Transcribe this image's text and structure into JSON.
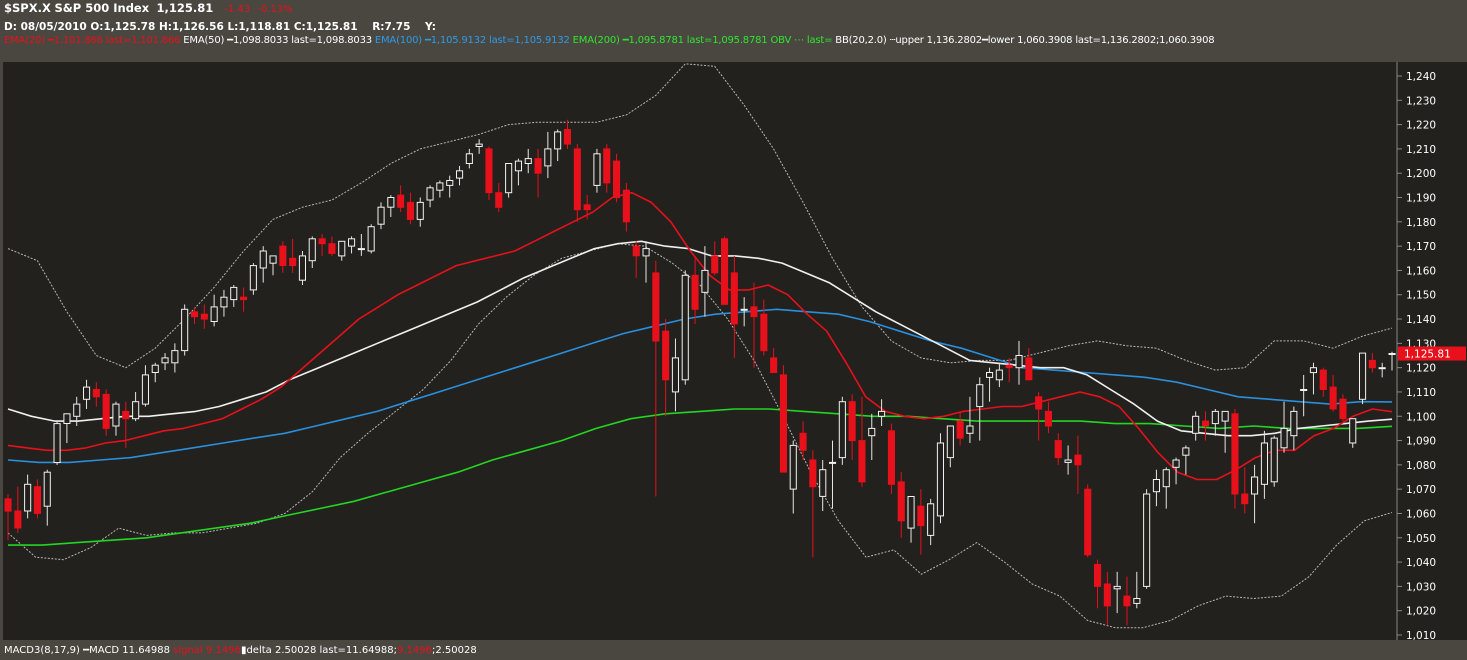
{
  "header": {
    "symbol": "$SPX.X",
    "name": "S&P 500 Index",
    "last": "1,125.81",
    "change": "-1.43",
    "change_pct": "-0.13%",
    "date_label": "D:",
    "date": "08/05/2010",
    "open_label": "O:",
    "open": "1,125.78",
    "high_label": "H:",
    "high": "1,126.56",
    "low_label": "L:",
    "low": "1,118.81",
    "close_label": "C:",
    "close": "1,125.81",
    "range_label": "R:",
    "range": "7.75",
    "y_label": "Y:"
  },
  "indicators": {
    "ema20": "EMA(20) ━1,101.866 last=1,101.866",
    "ema50": "EMA(50) ━1,098.8033 last=1,098.8033",
    "ema100": "EMA(100) ━1,105.9132 last=1,105.9132",
    "ema200": "EMA(200) ━1,095.8781 last=1,095.8781",
    "obv": "OBV ⋯ last=",
    "bb": "BB(20,2.0) ┄upper 1,136.2802━lower 1,060.3908 last=1,136.2802;1,060.3908"
  },
  "footer": {
    "macd": "MACD3(8,17,9) ━MACD 11.64988",
    "signal": "signal 9.1496",
    "delta": "▮delta 2.50028 last=11.64988;",
    "last_signal": "9.1496",
    "last_delta": ";2.50028"
  },
  "colors": {
    "up_body": "#ffffff",
    "down_body": "#e8101a",
    "ema20": "#e8101a",
    "ema50": "#f0f0f0",
    "ema100": "#2a8fdc",
    "ema200": "#22d622",
    "bollinger": "#b8b8b8",
    "last_price_tag": "#e8101a",
    "plot_background": "#22211d"
  },
  "chart_data": {
    "type": "candlestick",
    "ylim": [
      1008,
      1248
    ],
    "y_ticks": [
      "1,010",
      "1,020",
      "1,030",
      "1,040",
      "1,050",
      "1,060",
      "1,070",
      "1,080",
      "1,090",
      "1,100",
      "1,110",
      "1,120",
      "1,130",
      "1,140",
      "1,150",
      "1,160",
      "1,170",
      "1,180",
      "1,190",
      "1,200",
      "1,210",
      "1,220",
      "1,230",
      "1,240"
    ],
    "last_price_label": "1,125.81",
    "last_price": 1125.81,
    "candles": [
      [
        1066,
        1068,
        1049,
        1061
      ],
      [
        1061,
        1071,
        1052,
        1054
      ],
      [
        1061,
        1076,
        1058,
        1072
      ],
      [
        1071,
        1074,
        1058,
        1060
      ],
      [
        1063,
        1078,
        1055,
        1077
      ],
      [
        1081,
        1098,
        1080,
        1097
      ],
      [
        1097,
        1101,
        1089,
        1101
      ],
      [
        1100,
        1108,
        1096,
        1105
      ],
      [
        1107,
        1115,
        1103,
        1112
      ],
      [
        1111,
        1114,
        1104,
        1108
      ],
      [
        1109,
        1111,
        1092,
        1095
      ],
      [
        1096,
        1106,
        1092,
        1105
      ],
      [
        1102,
        1106,
        1087,
        1099
      ],
      [
        1099,
        1110,
        1098,
        1106
      ],
      [
        1105,
        1121,
        1104,
        1117
      ],
      [
        1118,
        1122,
        1114,
        1121
      ],
      [
        1122,
        1126,
        1119,
        1124
      ],
      [
        1122,
        1130,
        1118,
        1127
      ],
      [
        1127,
        1146,
        1125,
        1144
      ],
      [
        1143,
        1145,
        1138,
        1141
      ],
      [
        1142,
        1146,
        1136,
        1140
      ],
      [
        1139,
        1150,
        1137,
        1145
      ],
      [
        1145,
        1152,
        1141,
        1149
      ],
      [
        1148,
        1154,
        1145,
        1153
      ],
      [
        1149,
        1153,
        1143,
        1148
      ],
      [
        1152,
        1163,
        1150,
        1162
      ],
      [
        1161,
        1170,
        1155,
        1168
      ],
      [
        1163,
        1166,
        1158,
        1166
      ],
      [
        1170,
        1172,
        1159,
        1162
      ],
      [
        1165,
        1173,
        1159,
        1162
      ],
      [
        1156,
        1168,
        1154,
        1166
      ],
      [
        1164,
        1174,
        1161,
        1173
      ],
      [
        1173,
        1175,
        1166,
        1171
      ],
      [
        1171,
        1174,
        1166,
        1167
      ],
      [
        1166,
        1172,
        1164,
        1172
      ],
      [
        1170,
        1174,
        1167,
        1173
      ],
      [
        1169,
        1175,
        1166,
        1169
      ],
      [
        1168,
        1179,
        1167,
        1178
      ],
      [
        1179,
        1188,
        1177,
        1186
      ],
      [
        1186,
        1191,
        1182,
        1190
      ],
      [
        1191,
        1195,
        1184,
        1186
      ],
      [
        1188,
        1192,
        1179,
        1181
      ],
      [
        1181,
        1190,
        1178,
        1188
      ],
      [
        1189,
        1195,
        1186,
        1194
      ],
      [
        1193,
        1197,
        1190,
        1196
      ],
      [
        1195,
        1199,
        1190,
        1197
      ],
      [
        1198,
        1203,
        1195,
        1201
      ],
      [
        1204,
        1210,
        1202,
        1208
      ],
      [
        1211,
        1214,
        1208,
        1212
      ],
      [
        1210,
        1211,
        1189,
        1192
      ],
      [
        1192,
        1196,
        1184,
        1186
      ],
      [
        1192,
        1204,
        1190,
        1204
      ],
      [
        1201,
        1206,
        1195,
        1205
      ],
      [
        1204,
        1210,
        1200,
        1206
      ],
      [
        1206,
        1210,
        1190,
        1200
      ],
      [
        1203,
        1217,
        1198,
        1210
      ],
      [
        1210,
        1218,
        1205,
        1217
      ],
      [
        1218,
        1222,
        1210,
        1212
      ],
      [
        1210,
        1212,
        1180,
        1185
      ],
      [
        1187,
        1191,
        1181,
        1185
      ],
      [
        1195,
        1210,
        1192,
        1208
      ],
      [
        1210,
        1212,
        1192,
        1196
      ],
      [
        1205,
        1208,
        1188,
        1190
      ],
      [
        1193,
        1196,
        1176,
        1180
      ],
      [
        1170,
        1172,
        1157,
        1166
      ],
      [
        1166,
        1172,
        1155,
        1169
      ],
      [
        1159,
        1164,
        1067,
        1131
      ],
      [
        1135,
        1140,
        1100,
        1115
      ],
      [
        1110,
        1132,
        1102,
        1124
      ],
      [
        1115,
        1160,
        1113,
        1158
      ],
      [
        1158,
        1165,
        1138,
        1144
      ],
      [
        1151,
        1170,
        1141,
        1160
      ],
      [
        1166,
        1172,
        1158,
        1159
      ],
      [
        1173,
        1174,
        1146,
        1146
      ],
      [
        1159,
        1166,
        1124,
        1138
      ],
      [
        1144,
        1149,
        1137,
        1144
      ],
      [
        1145,
        1155,
        1120,
        1141
      ],
      [
        1142,
        1148,
        1125,
        1127
      ],
      [
        1124,
        1128,
        1118,
        1118
      ],
      [
        1117,
        1121,
        1077,
        1077
      ],
      [
        1070,
        1090,
        1060,
        1088
      ],
      [
        1093,
        1098,
        1082,
        1086
      ],
      [
        1082,
        1086,
        1042,
        1071
      ],
      [
        1067,
        1082,
        1061,
        1078
      ],
      [
        1081,
        1090,
        1062,
        1081
      ],
      [
        1083,
        1108,
        1080,
        1106
      ],
      [
        1106,
        1109,
        1082,
        1090
      ],
      [
        1090,
        1108,
        1071,
        1073
      ],
      [
        1092,
        1101,
        1082,
        1095
      ],
      [
        1100,
        1107,
        1096,
        1102
      ],
      [
        1094,
        1097,
        1068,
        1072
      ],
      [
        1073,
        1077,
        1050,
        1057
      ],
      [
        1054,
        1062,
        1048,
        1067
      ],
      [
        1063,
        1070,
        1043,
        1055
      ],
      [
        1051,
        1066,
        1047,
        1064
      ],
      [
        1059,
        1093,
        1056,
        1089
      ],
      [
        1083,
        1096,
        1079,
        1096
      ],
      [
        1098,
        1102,
        1088,
        1091
      ],
      [
        1093,
        1108,
        1089,
        1096
      ],
      [
        1104,
        1116,
        1090,
        1113
      ],
      [
        1116,
        1120,
        1106,
        1118
      ],
      [
        1115,
        1122,
        1112,
        1119
      ],
      [
        1121,
        1124,
        1114,
        1120
      ],
      [
        1120,
        1131,
        1113,
        1125
      ],
      [
        1124,
        1128,
        1115,
        1115
      ],
      [
        1108,
        1110,
        1090,
        1103
      ],
      [
        1102,
        1106,
        1093,
        1096
      ],
      [
        1090,
        1093,
        1080,
        1083
      ],
      [
        1081,
        1088,
        1076,
        1082
      ],
      [
        1084,
        1092,
        1068,
        1080
      ],
      [
        1070,
        1072,
        1042,
        1043
      ],
      [
        1039,
        1041,
        1021,
        1030
      ],
      [
        1031,
        1036,
        1014,
        1022
      ],
      [
        1029,
        1036,
        1019,
        1030
      ],
      [
        1026,
        1034,
        1014,
        1022
      ],
      [
        1023,
        1036,
        1021,
        1025
      ],
      [
        1030,
        1070,
        1029,
        1068
      ],
      [
        1069,
        1078,
        1063,
        1074
      ],
      [
        1071,
        1079,
        1062,
        1078
      ],
      [
        1079,
        1083,
        1072,
        1082
      ],
      [
        1084,
        1088,
        1076,
        1087
      ],
      [
        1093,
        1102,
        1090,
        1100
      ],
      [
        1098,
        1102,
        1090,
        1096
      ],
      [
        1097,
        1103,
        1092,
        1102
      ],
      [
        1098,
        1101,
        1085,
        1102
      ],
      [
        1101,
        1103,
        1062,
        1068
      ],
      [
        1068,
        1079,
        1060,
        1064
      ],
      [
        1068,
        1080,
        1056,
        1075
      ],
      [
        1072,
        1094,
        1066,
        1089
      ],
      [
        1073,
        1092,
        1071,
        1091
      ],
      [
        1087,
        1106,
        1085,
        1095
      ],
      [
        1092,
        1104,
        1086,
        1102
      ],
      [
        1111,
        1117,
        1100,
        1111
      ],
      [
        1118,
        1122,
        1109,
        1120
      ],
      [
        1119,
        1120,
        1108,
        1111
      ],
      [
        1112,
        1117,
        1102,
        1103
      ],
      [
        1107,
        1109,
        1098,
        1099
      ],
      [
        1089,
        1099,
        1087,
        1099
      ],
      [
        1107,
        1126,
        1105,
        1126
      ],
      [
        1123,
        1126,
        1118,
        1120
      ],
      [
        1120,
        1122,
        1116,
        1120
      ],
      [
        1125.78,
        1126.56,
        1118.81,
        1125.81
      ]
    ],
    "ema20": [
      1088,
      1087,
      1086,
      1086,
      1087,
      1089,
      1090,
      1092,
      1094,
      1095,
      1097,
      1099,
      1103,
      1107,
      1112,
      1119,
      1126,
      1133,
      1140,
      1145,
      1150,
      1154,
      1158,
      1162,
      1164,
      1166,
      1168,
      1172,
      1176,
      1180,
      1184,
      1190,
      1192,
      1188,
      1180,
      1168,
      1158,
      1152,
      1152,
      1154,
      1150,
      1142,
      1135,
      1122,
      1108,
      1102,
      1100,
      1099,
      1100,
      1102,
      1103,
      1104,
      1104,
      1106,
      1108,
      1110,
      1108,
      1104,
      1095,
      1085,
      1077,
      1074,
      1074,
      1078,
      1083,
      1086,
      1086,
      1092,
      1095,
      1100,
      1103,
      1101.87
    ],
    "ema50": [
      1103,
      1100,
      1098,
      1098,
      1099,
      1100,
      1100,
      1101,
      1102,
      1104,
      1107,
      1110,
      1115,
      1119,
      1123,
      1127,
      1131,
      1135,
      1139,
      1143,
      1147,
      1152,
      1157,
      1161,
      1165,
      1169,
      1171,
      1172,
      1170,
      1169,
      1166,
      1166,
      1165,
      1163,
      1159,
      1155,
      1149,
      1143,
      1138,
      1133,
      1128,
      1123,
      1122,
      1121,
      1120,
      1120,
      1117,
      1111,
      1105,
      1098,
      1094,
      1093,
      1092,
      1092,
      1093,
      1095,
      1096,
      1097,
      1098,
      1098.8
    ],
    "ema100": [
      1082,
      1081,
      1081,
      1082,
      1083,
      1085,
      1087,
      1089,
      1091,
      1093,
      1096,
      1099,
      1102,
      1106,
      1110,
      1114,
      1118,
      1122,
      1126,
      1130,
      1134,
      1137,
      1140,
      1142,
      1143,
      1144,
      1143,
      1142,
      1139,
      1135,
      1131,
      1128,
      1124,
      1120,
      1119,
      1118,
      1117,
      1116,
      1114,
      1111,
      1108,
      1107,
      1106,
      1105,
      1106,
      1105.91
    ],
    "ema200": [
      1047,
      1047,
      1048,
      1049,
      1050,
      1052,
      1054,
      1056,
      1059,
      1062,
      1065,
      1069,
      1073,
      1077,
      1082,
      1086,
      1090,
      1095,
      1099,
      1101,
      1102,
      1103,
      1103,
      1102,
      1101,
      1100,
      1100,
      1099,
      1098,
      1098,
      1098,
      1098,
      1097,
      1097,
      1096,
      1095,
      1096,
      1095,
      1095,
      1095,
      1095.88
    ],
    "bb_upper": [
      1169,
      1164,
      1143,
      1125,
      1120,
      1128,
      1140,
      1153,
      1168,
      1181,
      1186,
      1189,
      1196,
      1204,
      1210,
      1213,
      1216,
      1220,
      1221,
      1221,
      1221,
      1224,
      1232,
      1245,
      1244,
      1228,
      1210,
      1188,
      1165,
      1145,
      1131,
      1124,
      1122,
      1123,
      1123,
      1126,
      1129,
      1131,
      1129,
      1128,
      1123,
      1119,
      1120,
      1131,
      1131,
      1128,
      1133,
      1136.28
    ],
    "bb_lower": [
      1052,
      1042,
      1041,
      1046,
      1054,
      1051,
      1052,
      1052,
      1054,
      1056,
      1060,
      1069,
      1083,
      1093,
      1102,
      1111,
      1123,
      1138,
      1149,
      1158,
      1165,
      1168,
      1171,
      1170,
      1163,
      1154,
      1140,
      1122,
      1100,
      1077,
      1057,
      1042,
      1045,
      1035,
      1041,
      1048,
      1040,
      1031,
      1026,
      1016,
      1013,
      1013,
      1016,
      1022,
      1026,
      1025,
      1026,
      1034,
      1047,
      1057,
      1060.39
    ]
  }
}
